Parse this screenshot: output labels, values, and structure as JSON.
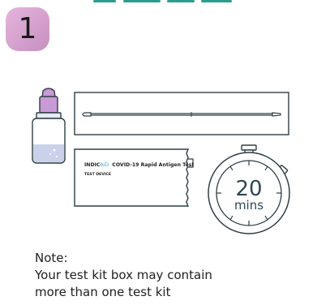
{
  "step": {
    "number": "1"
  },
  "device_card": {
    "brand_prefix": "INDIC",
    "brand_suffix": "AID",
    "product": "COVID-19 Rapid Antigen Test",
    "label": "TEST DEVICE"
  },
  "timer": {
    "value": "20",
    "unit": "mins"
  },
  "note": {
    "title": "Note:",
    "line1": "Your test kit box may contain",
    "line2": "more than one test kit"
  },
  "colors": {
    "badge": "#d7a3cf",
    "outline": "#2f3e44",
    "vial_cap": "#c99ad6",
    "vial_liquid": "#c9d2ea",
    "header_teal": "#2a9d8f",
    "brand_accent": "#3bb0c9"
  }
}
